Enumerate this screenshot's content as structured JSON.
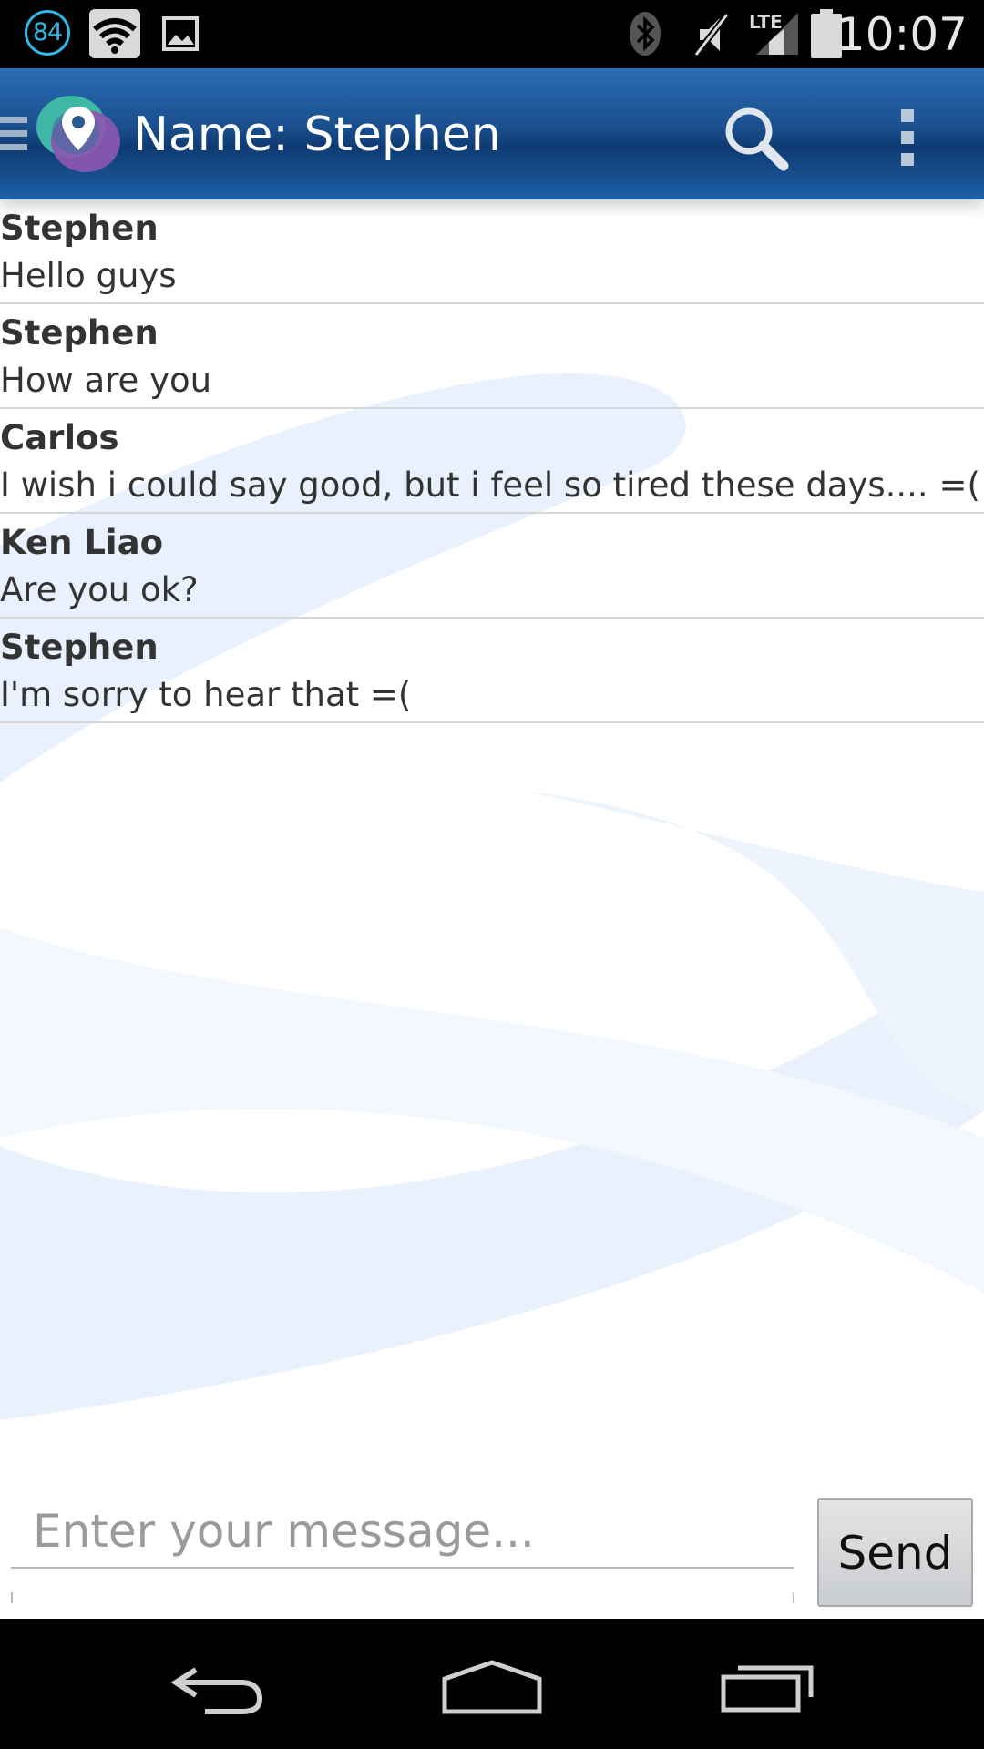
{
  "status_bar": {
    "notification_count": "84",
    "time": "10:07",
    "network": "LTE",
    "icons": [
      "wifi-icon",
      "image-icon",
      "bluetooth-icon",
      "mute-icon",
      "signal-icon",
      "battery-icon"
    ]
  },
  "action_bar": {
    "title": "Name: Stephen",
    "icons": [
      "drawer-icon",
      "app-logo-pin-icon",
      "search-icon",
      "overflow-menu-icon"
    ]
  },
  "messages": [
    {
      "sender": "Stephen",
      "text": "Hello guys"
    },
    {
      "sender": "Stephen",
      "text": "How are you"
    },
    {
      "sender": "Carlos",
      "text": "I wish i could say good, but i feel so tired these days.... =("
    },
    {
      "sender": "Ken Liao",
      "text": "Are you ok?"
    },
    {
      "sender": "Stephen",
      "text": "I'm sorry to hear that =("
    }
  ],
  "compose": {
    "placeholder": "Enter your message...",
    "value": "",
    "send_label": "Send"
  },
  "nav_bar": {
    "icons": [
      "back-icon",
      "home-icon",
      "recent-apps-icon"
    ]
  },
  "colors": {
    "action_bar": "#1a4f8e",
    "accent": "#33b5e5",
    "text": "#333333",
    "divider": "#d6d6d6"
  }
}
